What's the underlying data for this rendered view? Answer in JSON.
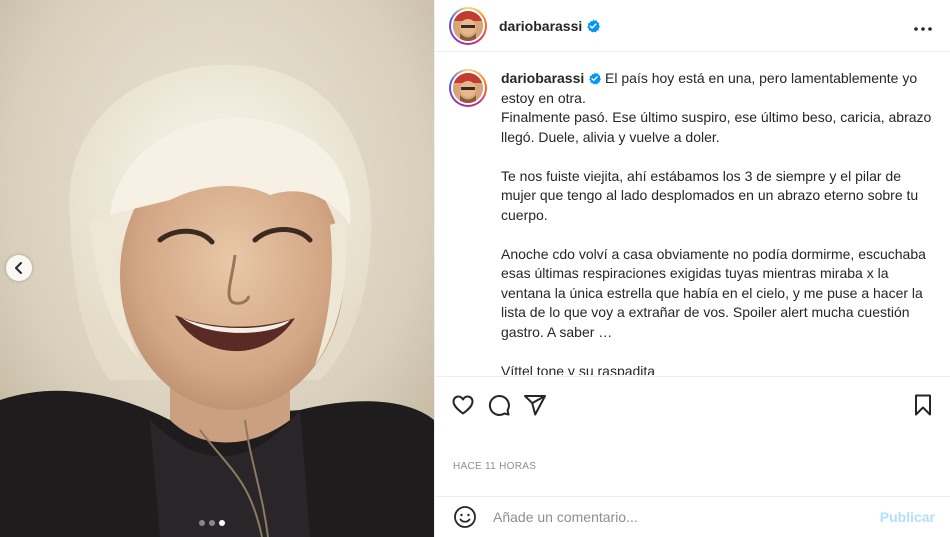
{
  "post": {
    "username": "dariobarassi",
    "caption_paragraphs": [
      "El país hoy está en una, pero lamentablemente yo estoy en otra.\nFinalmente pasó. Ese último suspiro, ese último beso, caricia, abrazo llegó. Duele, alivia y vuelve a doler.",
      "Te nos fuiste viejita, ahí estábamos los 3 de siempre y el pilar de mujer que tengo al lado desplomados en un abrazo eterno sobre tu cuerpo.",
      "Anoche cdo volví a casa obviamente no podía dormirme, escuchaba esas últimas respiraciones exigidas tuyas mientras miraba x la ventana la única estrella que había en el cielo, y me puse a hacer la lista de lo que voy a extrañar de vos. Spoiler alert mucha cuestión gastro. A saber …",
      "Víttel tone y su raspadita"
    ],
    "timestamp": "HACE 11 HORAS"
  },
  "header": {
    "more_icon": "more-horizontal-icon"
  },
  "comment": {
    "placeholder": "Añade un comentario...",
    "post_label": "Publicar"
  },
  "carousel": {
    "total": 3,
    "active_index": 2
  },
  "colors": {
    "verified": "#0095f6",
    "post_button_disabled": "#b2dffc",
    "timestamp": "#8e8e8e"
  }
}
